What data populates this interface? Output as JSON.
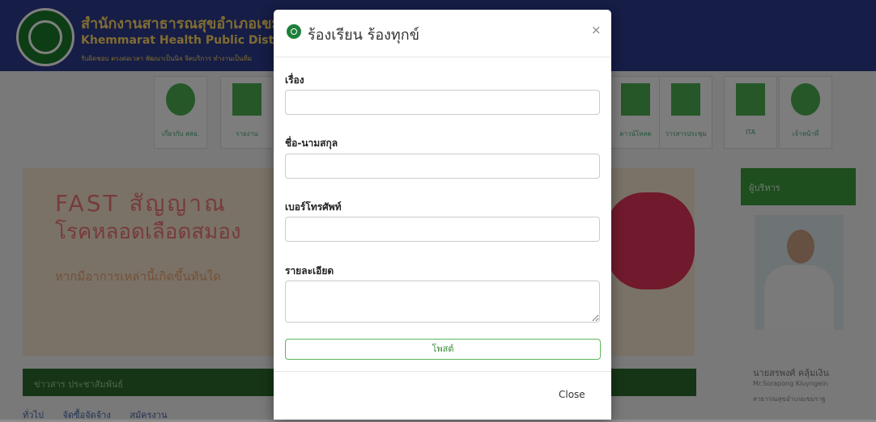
{
  "background": {
    "header": {
      "title_th": "สำนักงานสาธารณสุขอำเภอเขมราฐ",
      "title_en": "Khemmarat Health Public District",
      "slogan": "รับผิดชอบ ตรงต่อเวลา พัฒนาเป็นนิจ จิตบริการ ทำงานเป็นทีม"
    },
    "nav": [
      {
        "label": "เกี่ยวกับ สสอ.",
        "icon": "info-icon"
      },
      {
        "label": "รายงาน",
        "icon": "bookmark-icon"
      },
      {
        "label": "ดาวน์โหลด",
        "icon": "download-icon"
      },
      {
        "label": "วารสารประชุม",
        "icon": "document-icon"
      },
      {
        "label": "ITA",
        "icon": "star-icon"
      },
      {
        "label": "เจ้าหน้าที่",
        "icon": "user-icon"
      }
    ],
    "banner": {
      "line1": "FAST สัญญาณ",
      "line2": "โรคหลอดเลือดสมอง",
      "line3": "หากมีอาการเหล่านี้เกิดขึ้นทันใด"
    },
    "sidebar": {
      "heading": "ผู้บริหาร",
      "name": "นายสรพงศ์ คลุ้มเงิน",
      "name_en": "Mr.Sorapong Kluyngein",
      "position": "สาธารณสุขอำเภอเขมราฐ"
    },
    "news": {
      "heading": "ข่าวสาร ประชาสัมพันธ์",
      "links": [
        "ทั่วไป",
        "จัดซื้อจัดจ้าง",
        "สมัครงาน"
      ]
    }
  },
  "modal": {
    "title": "ร้องเรียน ร้องทุกข์",
    "close_symbol": "×",
    "fields": {
      "subject_label": "เรื่อง",
      "subject_value": "",
      "name_label": "ชื่อ-นามสกุล",
      "name_value": "",
      "phone_label": "เบอร์โทรศัพท์",
      "phone_value": "",
      "detail_label": "รายละเอียด",
      "detail_value": ""
    },
    "post_button": "โพสต์",
    "close_button": "Close"
  },
  "colors": {
    "accent_green": "#5cb85c",
    "header_blue": "#2d3a8c",
    "overlay": "rgba(0,0,0,0.5)"
  }
}
